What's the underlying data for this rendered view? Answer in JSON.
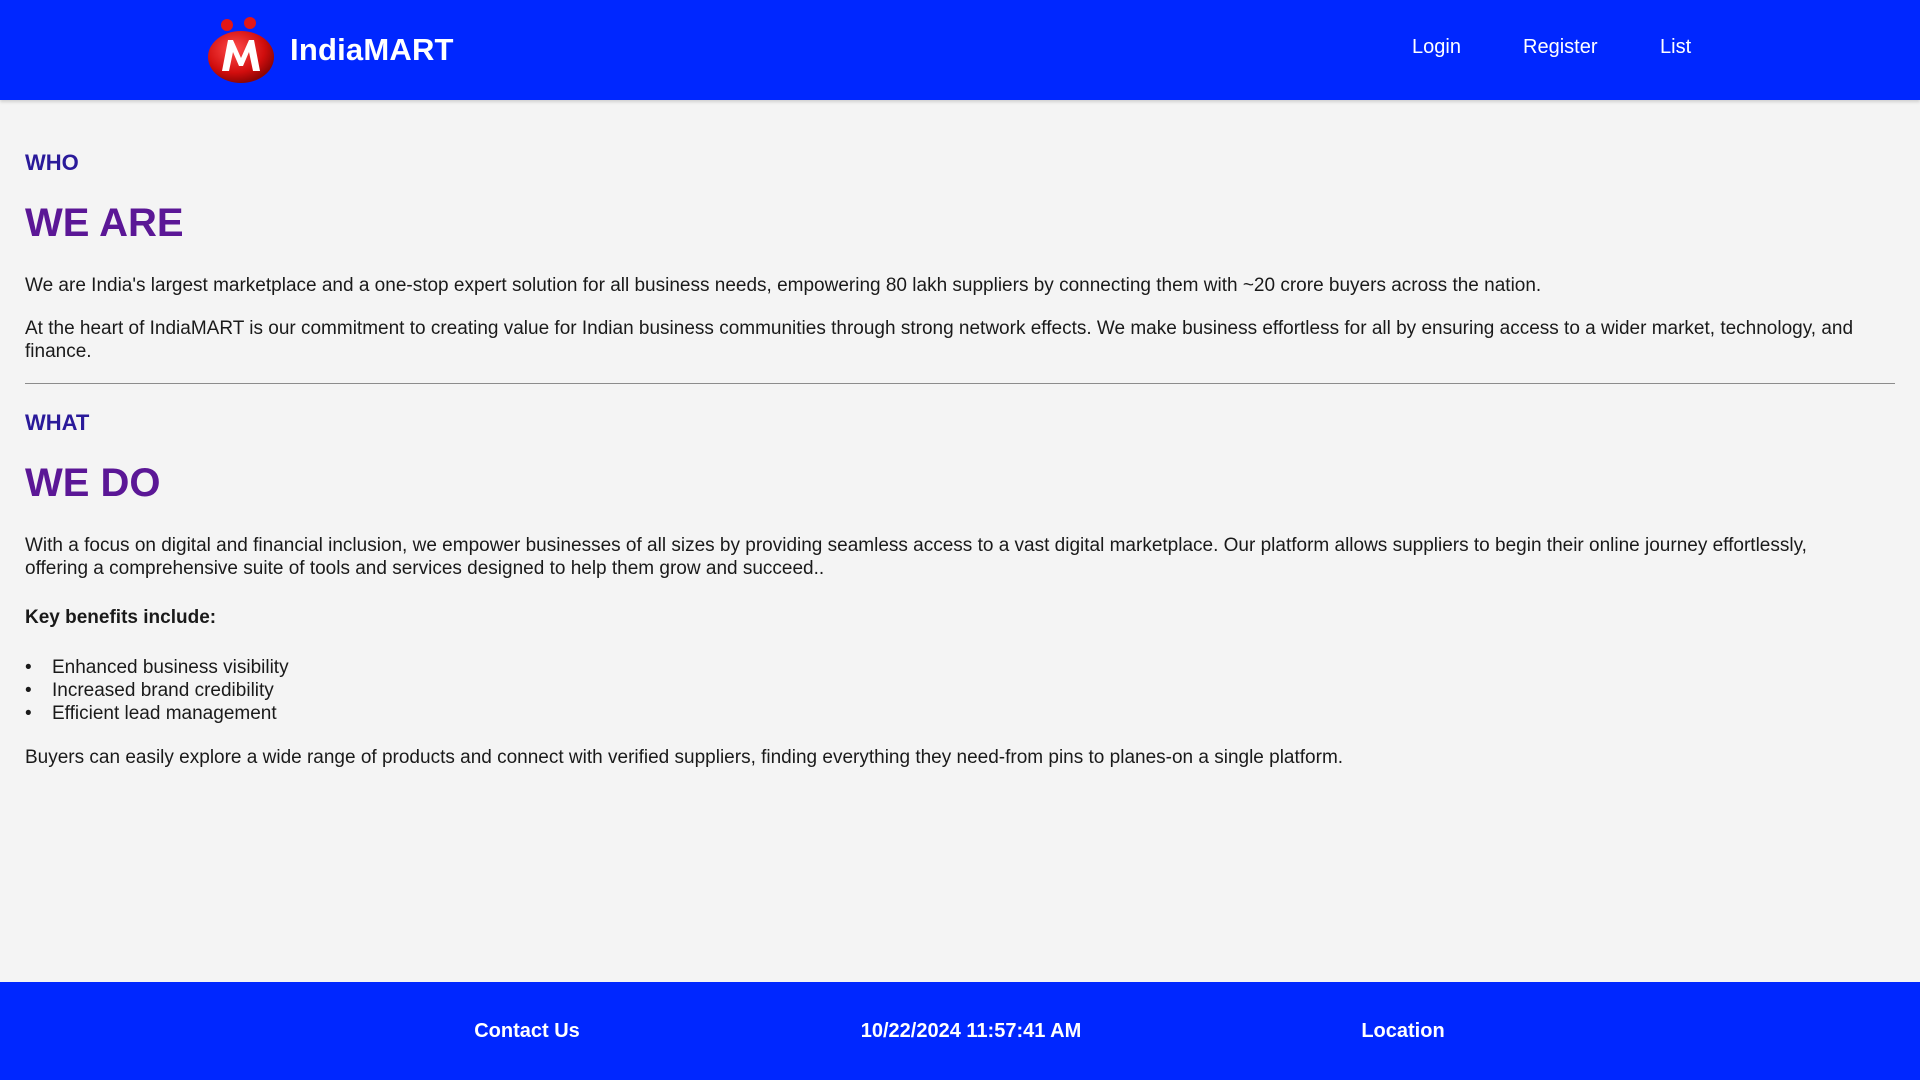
{
  "header": {
    "brand_name": "IndiaMART",
    "logo_icon": "indiamart-logo-icon",
    "nav": {
      "login": "Login",
      "register": "Register",
      "list": "List"
    }
  },
  "colors": {
    "header_bg": "#0027ff",
    "footer_bg": "#0027ff",
    "eyebrow": "#2a1a9a",
    "heading": "#5b1796",
    "page_bg": "#f4f4f4"
  },
  "who_section": {
    "eyebrow": "WHO",
    "heading": "WE ARE",
    "paragraph_1": "We are India's largest marketplace and a one-stop expert solution for all business needs, empowering 80 lakh suppliers by connecting them with ~20 crore buyers across the nation.",
    "paragraph_2": "At the heart of IndiaMART is our commitment to creating value for Indian business communities through strong network effects. We make business effortless for all by ensuring access to a wider market, technology, and finance."
  },
  "what_section": {
    "eyebrow": "WHAT",
    "heading": "WE DO",
    "paragraph_1": "With a focus on digital and financial inclusion, we empower businesses of all sizes by providing seamless access to a vast digital marketplace. Our platform allows suppliers to begin their online journey effortlessly, offering a comprehensive suite of tools and services designed to help them grow and succeed..",
    "benefits_label": "Key benefits include:",
    "benefits": [
      "Enhanced business visibility",
      "Increased brand credibility",
      "Efficient lead management"
    ],
    "closing": "Buyers can easily explore a wide range of products and connect with verified suppliers, finding everything they need-from pins to planes-on a single platform."
  },
  "footer": {
    "contact": "Contact Us",
    "datetime": "10/22/2024 11:57:41 AM",
    "location": "Location"
  }
}
